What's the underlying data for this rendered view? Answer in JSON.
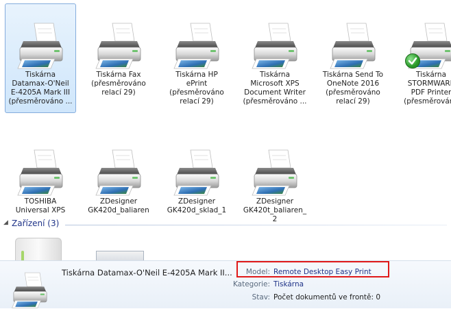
{
  "printers": [
    {
      "label": "Tiskárna\nDatamax-O'Neil\nE-4205A Mark III\n(přesměrováno ...",
      "selected": true,
      "default": false
    },
    {
      "label": "Tiskárna Fax\n(přesměrováno\nrelací 29)",
      "selected": false,
      "default": false
    },
    {
      "label": "Tiskárna HP\nePrint\n(přesměrováno\nrelací 29)",
      "selected": false,
      "default": false
    },
    {
      "label": "Tiskárna\nMicrosoft XPS\nDocument Writer\n(přesměrováno ...",
      "selected": false,
      "default": false
    },
    {
      "label": "Tiskárna Send To\nOneNote 2016\n(přesměrováno\nrelací 29)",
      "selected": false,
      "default": false
    },
    {
      "label": "Tiskárna\nSTORMWARE\nPDF Printer\n(přesměrováno",
      "selected": false,
      "default": true
    },
    {
      "label": "TOSHIBA\nUniversal XPS",
      "selected": false,
      "default": false
    },
    {
      "label": "ZDesigner\nGK420d_baliaren",
      "selected": false,
      "default": false
    },
    {
      "label": "ZDesigner\nGK420d_sklad_1",
      "selected": false,
      "default": false
    },
    {
      "label": "ZDesigner\nGK420t_baliaren_\n2",
      "selected": false,
      "default": false
    }
  ],
  "group": {
    "title": "Zařízení (3)",
    "arrow": "◢"
  },
  "details": {
    "name": "Tiskárna Datamax-O'Neil E-4205A Mark II...",
    "model_label": "Model:",
    "model_value": "Remote Desktop Easy Print",
    "category_label": "Kategorie:",
    "category_value": "Tiskárna",
    "status_label": "Stav:",
    "status_value": "Počet dokumentů ve frontě: 0"
  },
  "colors": {
    "selection": "#cfe6fb",
    "highlight": "#e01818",
    "link": "#1e3287"
  }
}
